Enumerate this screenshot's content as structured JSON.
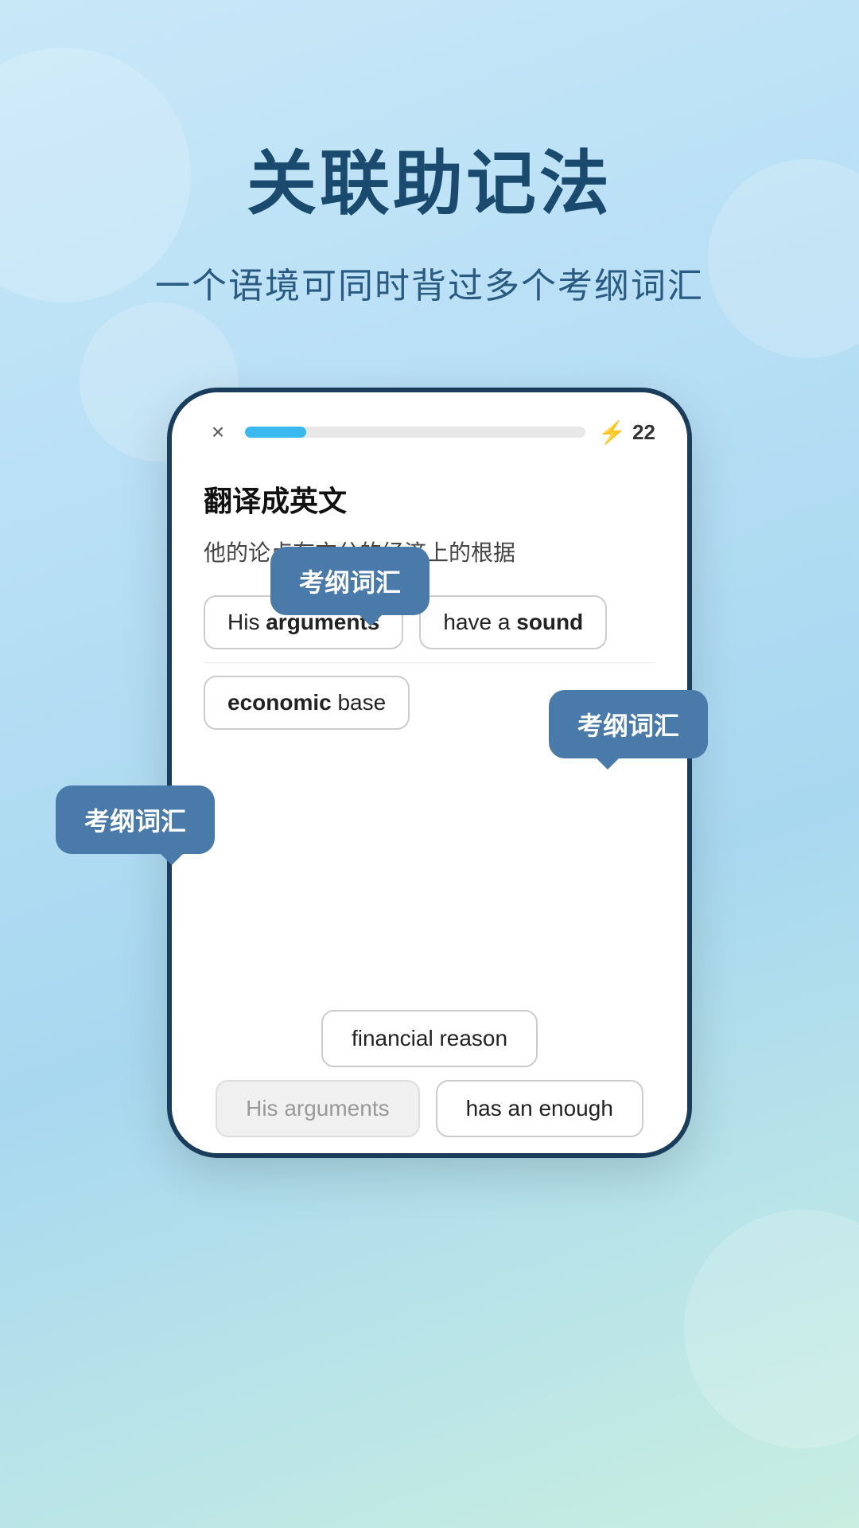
{
  "page": {
    "title": "关联助记法",
    "subtitle": "一个语境可同时背过多个考纲词汇",
    "background_gradient": "linear-gradient(160deg, #c8e8f8, #b8dff5, #a8d8f0, #c8eee0)"
  },
  "phone": {
    "close_icon": "×",
    "progress_fill_pct": 18,
    "score": "22",
    "score_icon": "⚡",
    "question_title": "翻译成英文",
    "question_text": "他的论点有充分的经济上的根据",
    "answer_rows": [
      {
        "chips": [
          {
            "text": "His ",
            "bold": "arguments",
            "rest": ""
          },
          {
            "text": "have a ",
            "bold": "sound",
            "rest": ""
          }
        ]
      },
      {
        "chips": [
          {
            "text": "",
            "bold": "economic",
            "rest": " base"
          }
        ]
      }
    ],
    "bottom_chips": [
      {
        "text": "financial reason",
        "grayed": false
      },
      {
        "text": "His arguments",
        "grayed": true
      },
      {
        "text": "has an enough",
        "grayed": false
      }
    ]
  },
  "tooltips": [
    {
      "id": "tooltip-1",
      "text": "考纲词汇"
    },
    {
      "id": "tooltip-2",
      "text": "考纲词汇"
    },
    {
      "id": "tooltip-3",
      "text": "考纲词汇"
    }
  ]
}
